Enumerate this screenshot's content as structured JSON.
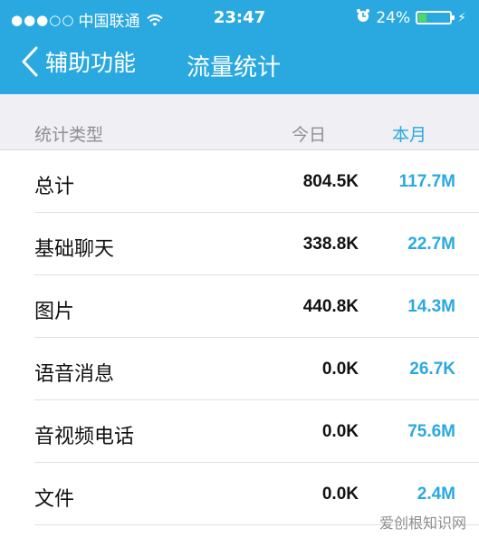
{
  "status_bar": {
    "signal": "●●●○○",
    "carrier": "中国联通",
    "time": "23:47",
    "battery_percent": "24%",
    "battery_level": 0.24
  },
  "nav": {
    "back_label": "辅助功能",
    "title": "流量统计"
  },
  "table": {
    "columns": [
      "统计类型",
      "今日",
      "本月"
    ],
    "rows": [
      {
        "type": "总计",
        "today": "804.5K",
        "month": "117.7M"
      },
      {
        "type": "基础聊天",
        "today": "338.8K",
        "month": "22.7M"
      },
      {
        "type": "图片",
        "today": "440.8K",
        "month": "14.3M"
      },
      {
        "type": "语音消息",
        "today": "0.0K",
        "month": "26.7K"
      },
      {
        "type": "音视频电话",
        "today": "0.0K",
        "month": "75.6M"
      },
      {
        "type": "文件",
        "today": "0.0K",
        "month": "2.4M"
      }
    ]
  },
  "watermark": "爱创根知识网",
  "colors": {
    "accent": "#2aa9e0",
    "battery_fill": "#4cd964"
  }
}
